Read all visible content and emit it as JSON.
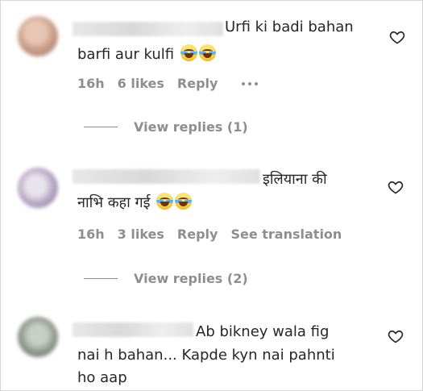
{
  "comments": [
    {
      "text_lines": [
        "Urfi ki badi bahan",
        "barfi aur kulfi"
      ],
      "emoji": [
        "face-with-tears-of-joy",
        "face-with-tears-of-joy"
      ],
      "time": "16h",
      "likes": "6 likes",
      "reply_label": "Reply",
      "more_label": "•••",
      "view_replies": "View replies (1)"
    },
    {
      "text_lines": [
        "इलियाना की",
        "नाभि कहा गई"
      ],
      "emoji": [
        "face-with-tears-of-joy",
        "face-with-tears-of-joy"
      ],
      "time": "16h",
      "likes": "3 likes",
      "reply_label": "Reply",
      "translation_label": "See translation",
      "view_replies": "View replies (2)"
    },
    {
      "text_lines": [
        "Ab bikney wala fig",
        "nai h bahan... Kapde kyn nai pahnti",
        "ho aap"
      ]
    }
  ],
  "colors": {
    "text": "#262626",
    "secondary": "#8e8e8e",
    "background": "#ffffff"
  },
  "icons": {
    "like": "heart-outline-icon",
    "more": "more-horizontal-icon"
  }
}
